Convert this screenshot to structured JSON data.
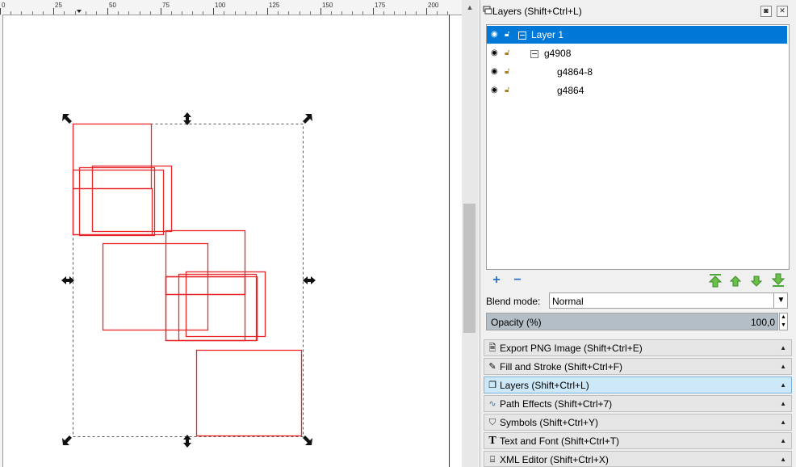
{
  "ruler": {
    "ticks": [
      "0",
      "25",
      "50",
      "75",
      "100",
      "125",
      "150",
      "175",
      "200"
    ]
  },
  "canvas": {
    "objects": [
      "rect-1",
      "rect-2",
      "rect-3",
      "rect-4",
      "rect-5",
      "rect-6",
      "rect-7",
      "rect-8",
      "rect-9",
      "rect-10",
      "rect-11",
      "rect-12",
      "rect-13"
    ]
  },
  "dock": {
    "title": "Layers (Shift+Ctrl+L)",
    "buttons": {
      "float": "◙",
      "close": "✕"
    },
    "layers": [
      {
        "label": "Layer 1",
        "selected": true
      },
      {
        "label": "g4908",
        "selected": false
      },
      {
        "label": "g4864-8",
        "selected": false
      },
      {
        "label": "g4864",
        "selected": false
      }
    ],
    "toolbar": {
      "add": "+",
      "remove": "−"
    },
    "blend": {
      "label": "Blend mode:",
      "value": "Normal"
    },
    "opacity": {
      "label": "Opacity (%)",
      "value": "100,0"
    },
    "dialogs": [
      {
        "label": "Export PNG Image (Shift+Ctrl+E)",
        "icon": "export-icon"
      },
      {
        "label": "Fill and Stroke (Shift+Ctrl+F)",
        "icon": "fill-stroke-icon"
      },
      {
        "label": "Layers (Shift+Ctrl+L)",
        "icon": "layers-icon"
      },
      {
        "label": "Path Effects  (Shift+Ctrl+7)",
        "icon": "path-effects-icon"
      },
      {
        "label": "Symbols (Shift+Ctrl+Y)",
        "icon": "symbols-icon"
      },
      {
        "label": "Text and Font (Shift+Ctrl+T)",
        "icon": "text-icon"
      },
      {
        "label": "XML Editor (Shift+Ctrl+X)",
        "icon": "xml-icon"
      }
    ]
  },
  "colors": {
    "selection": "#0078d7",
    "shape_stroke": "#e8262a",
    "active_tab": "#cde8f8"
  }
}
